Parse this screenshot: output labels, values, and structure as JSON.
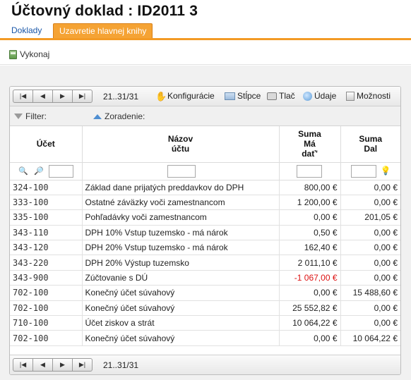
{
  "title": "Účtovný doklad :  ID2011 3",
  "tabs": [
    {
      "label": "Doklady",
      "active": false
    },
    {
      "label": "Uzavretie hlavnej knihy",
      "active": true
    }
  ],
  "actions": {
    "run_label": "Vykonaj"
  },
  "toolbar": {
    "range": "21..31/31",
    "configure": "Konfigurácie",
    "columns": "Stĺpce",
    "print": "Tlač",
    "data": "Údaje",
    "options": "Možnosti"
  },
  "filterbar": {
    "filter_label": "Filter:",
    "sort_label": "Zoradenie:"
  },
  "columns": {
    "account": "Účet",
    "name_line1": "Názov",
    "name_line2": "účtu",
    "debit_line1": "Suma",
    "debit_line2": "Má",
    "debit_line3": "dať'",
    "credit_line1": "Suma",
    "credit_line2": "Dal"
  },
  "rows": [
    {
      "account": "324-100",
      "name": "Základ dane prijatých preddavkov do DPH",
      "debit": "800,00 €",
      "credit": "0,00 €",
      "negative": false
    },
    {
      "account": "333-100",
      "name": "Ostatné záväzky voči zamestnancom",
      "debit": "1 200,00 €",
      "credit": "0,00 €",
      "negative": false
    },
    {
      "account": "335-100",
      "name": "Pohľadávky voči zamestnancom",
      "debit": "0,00 €",
      "credit": "201,05 €",
      "negative": false
    },
    {
      "account": "343-110",
      "name": "DPH 10% Vstup tuzemsko - má nárok",
      "debit": "0,50 €",
      "credit": "0,00 €",
      "negative": false
    },
    {
      "account": "343-120",
      "name": "DPH 20% Vstup tuzemsko - má nárok",
      "debit": "162,40 €",
      "credit": "0,00 €",
      "negative": false
    },
    {
      "account": "343-220",
      "name": "DPH 20% Výstup tuzemsko",
      "debit": "2 011,10 €",
      "credit": "0,00 €",
      "negative": false
    },
    {
      "account": "343-900",
      "name": "Zúčtovanie s DÚ",
      "debit": "-1 067,00 €",
      "credit": "0,00 €",
      "negative": true
    },
    {
      "account": "702-100",
      "name": "Konečný účet súvahový",
      "debit": "0,00 €",
      "credit": "15 488,60 €",
      "negative": false
    },
    {
      "account": "702-100",
      "name": "Konečný účet súvahový",
      "debit": "25 552,82 €",
      "credit": "0,00 €",
      "negative": false
    },
    {
      "account": "710-100",
      "name": "Účet ziskov a strát",
      "debit": "10 064,22 €",
      "credit": "0,00 €",
      "negative": false
    },
    {
      "account": "702-100",
      "name": "Konečný účet súvahový",
      "debit": "0,00 €",
      "credit": "10 064,22 €",
      "negative": false
    }
  ],
  "footer": {
    "range": "21..31/31"
  },
  "colors": {
    "accent": "#f39a25",
    "link": "#1a57a8",
    "negative": "#dd1111"
  }
}
